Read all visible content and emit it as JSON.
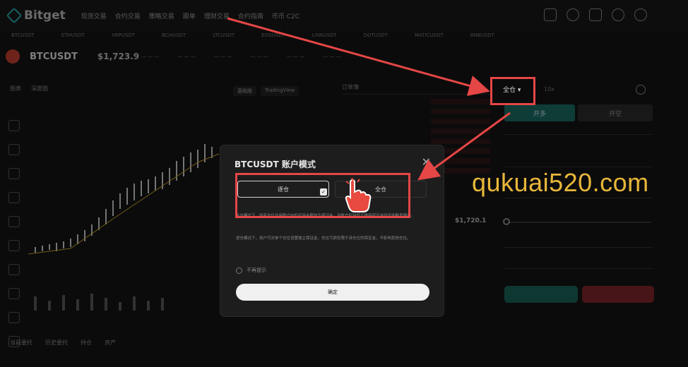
{
  "nav": {
    "logo": "Bitget",
    "items": [
      "现货交易",
      "合约交易",
      "策略交易",
      "跟单",
      "理财交易",
      "合约指南",
      "币币 C2C"
    ]
  },
  "ticker": [
    "BTCUSDT",
    "ETHUSDT",
    "XRPUSDT",
    "BCHUSDT",
    "LTCUSDT",
    "EOSUSDT",
    "LINKUSDT",
    "DOTUSDT",
    "MATICUSDT",
    "BNBUSDT"
  ],
  "symbol": {
    "name": "BTCUSDT",
    "price": "$1,723.9"
  },
  "chart": {
    "tabs": [
      "图表",
      "深度图"
    ],
    "options": [
      "基础版",
      "TradingView"
    ]
  },
  "book": {
    "tab": "订单簿",
    "price": "$1,720.1"
  },
  "panel": {
    "mode": "全仓",
    "buy_label": "开多",
    "sell_label": "开空"
  },
  "bottom_tabs": [
    "当前委托",
    "历史委托",
    "持仓",
    "资产"
  ],
  "modal": {
    "title": "BTCUSDT 账户模式",
    "option_isolated": "逐仓",
    "option_cross": "全仓",
    "desc1": "全仓模式下，所有仓位共用账户中的可用余额作为保证金，当账户权益低于维持保证金时可能触发爆仓。",
    "desc2": "逐仓模式下，用户可对单个仓位设置独立保证金，仓位亏损仅限于该仓位的保证金，不影响其他仓位。",
    "dont_show": "不再提示",
    "confirm": "确定"
  },
  "watermark": "qukuai520.com",
  "colors": {
    "annotation": "#e54646",
    "watermark": "#e8b73a",
    "buy": "#13695e",
    "sell": "#7a1f24"
  }
}
